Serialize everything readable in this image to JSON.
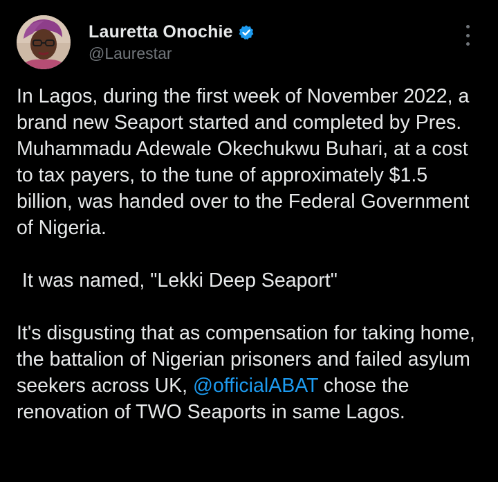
{
  "author": {
    "name": "Lauretta Onochie",
    "handle": "@Laurestar",
    "verified": true
  },
  "colors": {
    "background": "#000000",
    "text": "#e7e9ea",
    "secondary": "#71767b",
    "link": "#1d9bf0",
    "verified_badge": "#1d9bf0"
  },
  "icons": {
    "verified": "verified-badge-icon",
    "more": "more-vertical-icon"
  },
  "tweet": {
    "p1": "In Lagos, during the first week of November 2022, a brand new Seaport started and completed by Pres. Muhammadu Adewale Okechukwu Buhari, at a cost to tax payers, to the tune of approximately $1.5 billion, was handed over to the Federal Government of Nigeria.",
    "p2": " It was named, \"Lekki Deep Seaport\"",
    "p3_before": "It's disgusting that as compensation for taking home, the battalion of Nigerian prisoners and failed asylum seekers across UK, ",
    "p3_mention": "@officialABAT",
    "p3_after": " chose the renovation of TWO Seaports in same Lagos."
  }
}
